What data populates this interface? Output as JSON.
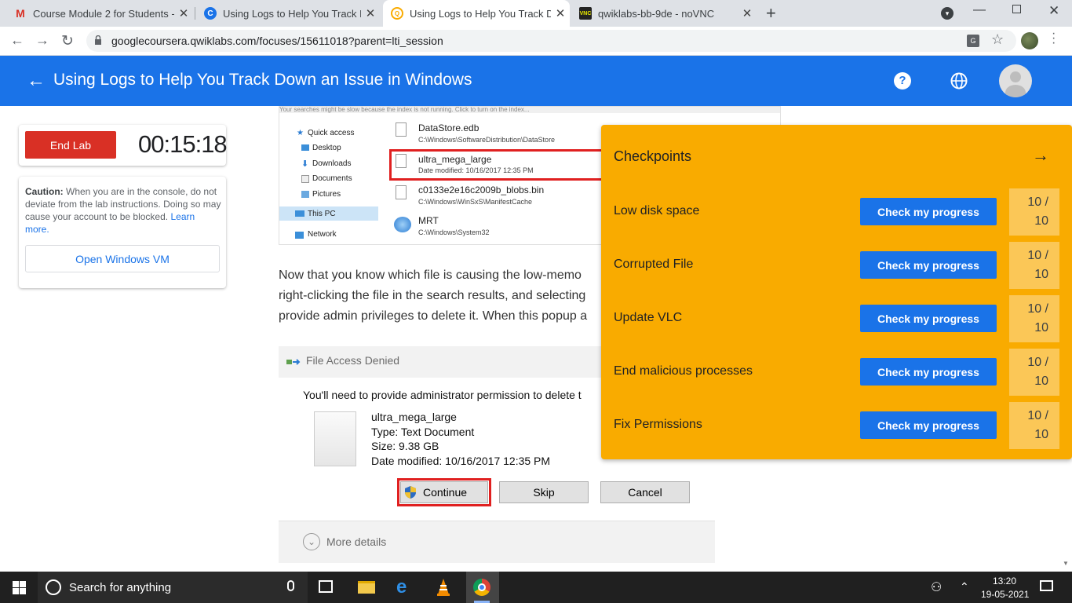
{
  "browser": {
    "tabs": [
      {
        "title": "Course Module 2 for Students - N",
        "icon": "gmail-icon"
      },
      {
        "title": "Using Logs to Help You Track Do",
        "icon": "coursera-icon"
      },
      {
        "title": "Using Logs to Help You Track Do",
        "icon": "qwiklabs-icon"
      },
      {
        "title": "qwiklabs-bb-9de - noVNC",
        "icon": "vnc-icon"
      }
    ],
    "url": "googlecoursera.qwiklabs.com/focuses/15611018?parent=lti_session"
  },
  "header": {
    "title": "Using Logs to Help You Track Down an Issue in Windows"
  },
  "lab": {
    "end_label": "End Lab",
    "timer": "00:15:18",
    "caution_label": "Caution:",
    "caution_text": " When you are in the console, do not deviate from the lab instructions. Doing so may cause your account to be blocked.",
    "learn_more": "Learn more.",
    "open_vm": "Open Windows VM"
  },
  "explorer": {
    "banner": "Your searches might be slow because the index is not running.  Click to turn on the index...",
    "nav": [
      "Quick access",
      "Desktop",
      "Downloads",
      "Documents",
      "Pictures",
      "This PC",
      "Network"
    ],
    "files": [
      {
        "name": "DataStore.edb",
        "sub": "C:\\Windows\\SoftwareDistribution\\DataStore"
      },
      {
        "name": "ultra_mega_large",
        "sub": "Date modified: 10/16/2017 12:35 PM"
      },
      {
        "name": "c0133e2e16c2009b_blobs.bin",
        "sub": "C:\\Windows\\WinSxS\\ManifestCache"
      },
      {
        "name": "MRT",
        "sub": "C:\\Windows\\System32"
      }
    ]
  },
  "instructions": {
    "line1": "Now that you know which file is causing the low-memo",
    "line2": "right-clicking the file in the search results, and selecting",
    "line3": "provide admin privileges to delete it. When this popup a"
  },
  "dialog": {
    "title": "File Access Denied",
    "message": "You'll need to provide administrator permission to delete t",
    "file_name": "ultra_mega_large",
    "file_type": "Type: Text Document",
    "file_size": "Size: 9.38 GB",
    "file_date": "Date modified: 10/16/2017 12:35 PM",
    "continue": "Continue",
    "skip": "Skip",
    "cancel": "Cancel",
    "more_details": "More details"
  },
  "checkpoints": {
    "title": "Checkpoints",
    "button_label": "Check my progress",
    "items": [
      {
        "label": "Low disk space",
        "score_top": "10 /",
        "score_bottom": "10"
      },
      {
        "label": "Corrupted File",
        "score_top": "10 /",
        "score_bottom": "10"
      },
      {
        "label": "Update VLC",
        "score_top": "10 /",
        "score_bottom": "10"
      },
      {
        "label": "End malicious processes",
        "score_top": "10 /",
        "score_bottom": "10"
      },
      {
        "label": "Fix Permissions",
        "score_top": "10 /",
        "score_bottom": "10"
      }
    ]
  },
  "taskbar": {
    "search": "Search for anything",
    "time": "13:20",
    "date": "19-05-2021"
  },
  "colors": {
    "accent": "#1a73e8",
    "checkpoint_bg": "#f9ab00",
    "end_lab": "#d93025"
  }
}
